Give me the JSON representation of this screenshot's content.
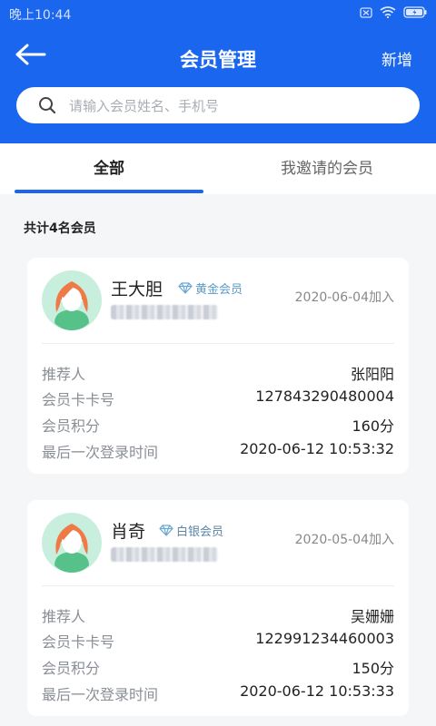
{
  "status_bar": {
    "time": "晚上10:44"
  },
  "navbar": {
    "title": "会员管理",
    "add_label": "新增"
  },
  "search": {
    "placeholder": "请输入会员姓名、手机号"
  },
  "tabs": [
    {
      "label": "全部"
    },
    {
      "label": "我邀请的会员"
    }
  ],
  "summary": {
    "count_text": "共计4名会员"
  },
  "field_labels": {
    "referrer": "推荐人",
    "card_no": "会员卡卡号",
    "points": "会员积分",
    "last_login": "最后一次登录时间"
  },
  "members": [
    {
      "name": "王大胆",
      "level": "黄金会员",
      "joined": "2020-06-04加入",
      "referrer": "张阳阳",
      "card_no": "127843290480004",
      "points": "160分",
      "last_login": "2020-06-12 10:53:32"
    },
    {
      "name": "肖奇",
      "level": "白银会员",
      "joined": "2020-05-04加入",
      "referrer": "吴姗姗",
      "card_no": "122991234460003",
      "points": "150分",
      "last_login": "2020-06-12 10:53:33"
    }
  ],
  "colors": {
    "brand": "#1a66ee",
    "background": "#f5f6f8",
    "avatar_bg": "#c8eede",
    "hair": "#f07a45",
    "shirt": "#56c28a"
  }
}
